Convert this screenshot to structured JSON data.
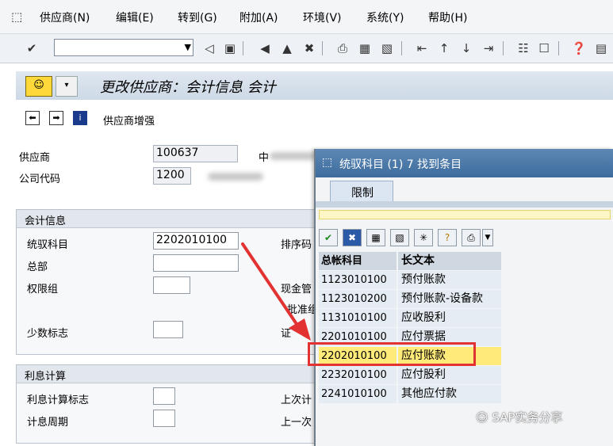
{
  "menu": {
    "items": [
      "供应商(N)",
      "编辑(E)",
      "转到(G)",
      "附加(A)",
      "环境(V)",
      "系统(Y)",
      "帮助(H)"
    ]
  },
  "toolbar": {
    "command_value": "",
    "icons": [
      "enter-icon",
      "back-icon",
      "save-icon",
      "exit-icon",
      "cancel-icon",
      "print-icon",
      "find-icon",
      "find-next-icon",
      "first-page-icon",
      "prev-page-icon",
      "next-page-icon",
      "last-page-icon",
      "new-session-icon",
      "shortcut-icon",
      "help-icon",
      "layout-icon"
    ]
  },
  "screen": {
    "title": "更改供应商：会计信息 会计",
    "app_toolbar": {
      "enhancement_label": "供应商增强"
    },
    "header_fields": {
      "vendor_label": "供应商",
      "vendor_value": "100637",
      "company_code_label": "公司代码",
      "company_code_value": "1200",
      "partial_label_1": "中"
    },
    "accounting_group": {
      "title": "会计信息",
      "recon_account_label": "统驭科目",
      "recon_account_value": "2202010100",
      "head_office_label": "总部",
      "head_office_value": "",
      "auth_group_label": "权限组",
      "auth_group_value": "",
      "minority_label": "少数标志",
      "minority_value": "",
      "sort_key_label": "排序码",
      "cash_mgmt_label": "现金管",
      "approval_label": "批准组",
      "cert_label": "证"
    },
    "interest_group": {
      "title": "利息计算",
      "interest_flag_label": "利息计算标志",
      "interest_flag_value": "",
      "interest_period_label": "计息周期",
      "interest_period_value": "",
      "last_calc_label": "上次计",
      "last_run_label": "上一次"
    }
  },
  "popup": {
    "title": "统驭科目 (1)   7 找到条目",
    "tab_label": "限制",
    "columns": [
      "总帐科目",
      "长文本"
    ],
    "rows": [
      {
        "account": "1123010100",
        "text": "预付账款"
      },
      {
        "account": "1123010200",
        "text": "预付账款-设备款"
      },
      {
        "account": "1131010100",
        "text": "应收股利"
      },
      {
        "account": "2201010100",
        "text": "应付票据"
      },
      {
        "account": "2202010100",
        "text": "应付账款"
      },
      {
        "account": "2232010100",
        "text": "应付股利"
      },
      {
        "account": "2241010100",
        "text": "其他应付款"
      }
    ],
    "selected_account": "2202010100"
  },
  "watermark": "SAP实务分享",
  "colors": {
    "highlight_border": "#e23232",
    "arrow": "#e23232",
    "selected_row": "#ffea7a",
    "popup_title": "#3d6c9d"
  }
}
